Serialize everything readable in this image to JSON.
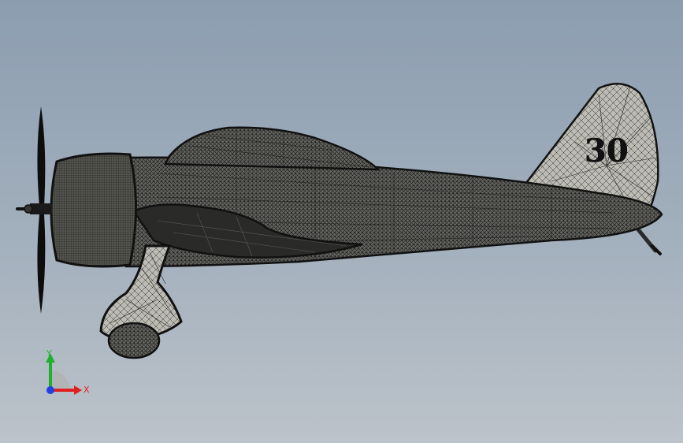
{
  "model": {
    "tail_marking": "30",
    "colors": {
      "wire": "#1a1a1a",
      "surface": "#d9d8d0",
      "fuselage": "#3a3a3a",
      "background_top": "#8c9db0",
      "background_bottom": "#bcc3ca"
    }
  },
  "triad": {
    "x_label": "X",
    "y_label": "Y",
    "colors": {
      "x": "#e02020",
      "y": "#20b030",
      "z": "#2040e0"
    }
  }
}
